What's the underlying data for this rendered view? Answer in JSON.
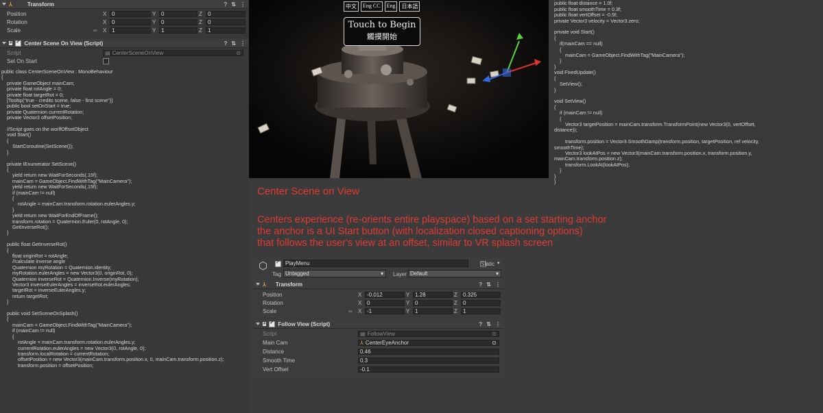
{
  "left": {
    "transform_header": "Transform",
    "rows": [
      {
        "label": "Position",
        "x": "0",
        "y": "0",
        "z": "0"
      },
      {
        "label": "Rotation",
        "x": "0",
        "y": "0",
        "z": "0"
      },
      {
        "label": "Scale",
        "x": "1",
        "y": "1",
        "z": "1"
      }
    ],
    "script_header": "Center Scene On View (Script)",
    "script_label": "Script",
    "script_value": "CenterSceneOnView",
    "set_on_start_label": "Set On Start",
    "code": "public class CenterSceneOnView : MonoBehaviour\n{\n    private GameObject mainCam;\n    private float rotAngle = 0;\n    private float targetRot = 0;\n    [Tooltip(\"true - credits scene, false - first scene\")]\n    public bool setOnStart = true;\n    private Quaternion currentRotation;\n    private Vector3 offsetPosition;\n\n    //Script goes on the worlfOffsetObject\n    void Start()\n    {\n        StartCoroutine(SetScene());\n    }\n\n    private IEnumerator SetScene()\n    {\n        yield return new WaitForSeconds(.15f);\n        mainCam = GameObject.FindWithTag(\"MainCamera\");\n        yield return new WaitForSeconds(.15f);\n        if (mainCam != null)\n        {\n            rotAngle = mainCam.transform.rotation.eulerAngles.y;\n        }\n        yield return new WaitForEndOfFrame();\n        transform.rotation = Quaternion.Euler(0, rotAngle, 0);\n        GetInverseRot();\n    }\n\n    public float GetInverseRot()\n    {\n        float originRot = rotAngle;\n        //calculate inverse angle\n        Quaternion myRotation = Quaternion.identity;\n        myRotation.eulerAngles = new Vector3(0, originRot, 0);\n        Quaternion inverseRot = Quaternion.Inverse(myRotation);\n        Vector3 inverseEulerAngles = inverseRot.eulerAngles;\n        targetRot = inverseEulerAngles.y;\n        return targetRot;\n    }\n\n    public void SetSceneOnSplash()\n    {\n        mainCam = GameObject.FindWithTag(\"MainCamera\");\n        if (mainCam != null)\n        {\n            rotAngle = mainCam.transform.rotation.eulerAngles.y;\n            currentRotation.eulerAngles = new Vector3(0, rotAngle, 0);\n            transform.localRotation = currentRotation;\n            offsetPosition = new Vector3(mainCam.transform.position.x, 0, mainCam.transform.position.z);\n            transform.position = offsetPosition;"
  },
  "scene": {
    "languages": [
      "中文",
      "Eng CC",
      "Eng",
      "日本語"
    ],
    "title_en": "Touch to Begin",
    "title_zh": "觸摸開始"
  },
  "right_code": "public GameObject mainCam;\npublic float distance = 1.0f;\npublic float smoothTime = 0.3f;\npublic float vertOffset = -0.5f;\nprivate Vector3 velocity = Vector3.zero;\n\nprivate void Start()\n{\n    if(mainCam == null)\n    {\n        mainCam = GameObject.FindWithTag(\"MainCamera\");\n    }\n}\nvoid FixedUpdate()\n{\n    SetView();\n}\n\nvoid SetView()\n{\n    if (mainCam != null)\n    {\n        Vector3 targetPosition = mainCam.transform.TransformPoint(new Vector3(0, vertOffset,\ndistance));\n\n        transform.position = Vector3.SmoothDamp(transform.position, targetPosition, ref velocity,\nsmoothTime);\n        Vector3 lookAtPos = new Vector3(mainCam.transform.position.x, transform.position.y,\nmainCam.transform.position.z);\n        transform.LookAt(lookAtPos);\n    }\n}\n}",
  "caption": {
    "title": "Center Scene on View",
    "lines": [
      "Centers experience (re-orients entire playspace) based on a set starting anchor",
      "the anchor is a UI Start button (with localization closed captioning options)",
      "that follows the user's view at an offset, similar to VR splash screen"
    ]
  },
  "inspector": {
    "object_name": "PlayMenu",
    "static_label": "Static",
    "tag_label": "Tag",
    "tag_value": "Untagged",
    "layer_label": "Layer",
    "layer_value": "Default",
    "transform_header": "Transform",
    "rows": [
      {
        "label": "Position",
        "x": "-0.012",
        "y": "1.28",
        "z": "0.325"
      },
      {
        "label": "Rotation",
        "x": "0",
        "y": "0",
        "z": "0"
      },
      {
        "label": "Scale",
        "x": "-1",
        "y": "1",
        "z": "1"
      }
    ],
    "follow_header": "Follow View (Script)",
    "fields": [
      {
        "label": "Script",
        "value": "FollowView"
      },
      {
        "label": "Main Cam",
        "value": "CenterEyeAnchor"
      },
      {
        "label": "Distance",
        "value": "0.46"
      },
      {
        "label": "Smooth Time",
        "value": "0.3"
      },
      {
        "label": "Vert Offset",
        "value": "-0.1"
      }
    ],
    "axes": [
      "X",
      "Y",
      "Z"
    ]
  }
}
